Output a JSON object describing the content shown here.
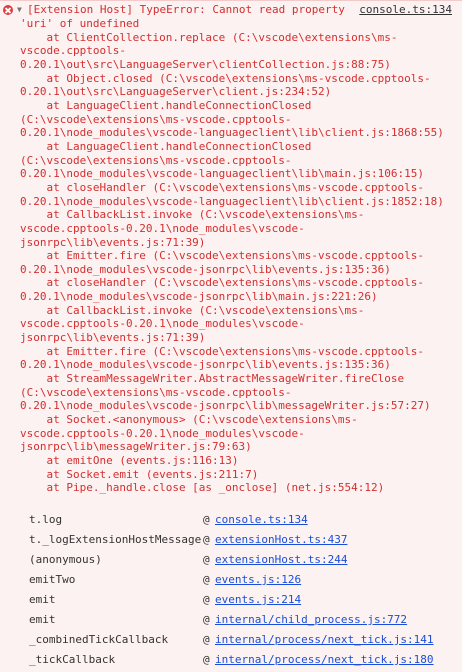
{
  "header": {
    "error_icon": "error-circle-icon",
    "expand_arrow": "▼",
    "message_line1": "[Extension Host] TypeError: Cannot read property",
    "source_link": "console.ts:134"
  },
  "stack_lines": [
    "'uri' of undefined",
    "    at ClientCollection.replace (C:\\vscode\\extensions\\ms-",
    "vscode.cpptools-",
    "0.20.1\\out\\src\\LanguageServer\\clientCollection.js:88:75)",
    "    at Object.closed (C:\\vscode\\extensions\\ms-vscode.cpptools-",
    "0.20.1\\out\\src\\LanguageServer\\client.js:234:52)",
    "    at LanguageClient.handleConnectionClosed",
    "(C:\\vscode\\extensions\\ms-vscode.cpptools-",
    "0.20.1\\node_modules\\vscode-languageclient\\lib\\client.js:1868:55)",
    "    at LanguageClient.handleConnectionClosed",
    "(C:\\vscode\\extensions\\ms-vscode.cpptools-",
    "0.20.1\\node_modules\\vscode-languageclient\\lib\\main.js:106:15)",
    "    at closeHandler (C:\\vscode\\extensions\\ms-vscode.cpptools-",
    "0.20.1\\node_modules\\vscode-languageclient\\lib\\client.js:1852:18)",
    "    at CallbackList.invoke (C:\\vscode\\extensions\\ms-",
    "vscode.cpptools-0.20.1\\node_modules\\vscode-",
    "jsonrpc\\lib\\events.js:71:39)",
    "    at Emitter.fire (C:\\vscode\\extensions\\ms-vscode.cpptools-",
    "0.20.1\\node_modules\\vscode-jsonrpc\\lib\\events.js:135:36)",
    "    at closeHandler (C:\\vscode\\extensions\\ms-vscode.cpptools-",
    "0.20.1\\node_modules\\vscode-jsonrpc\\lib\\main.js:221:26)",
    "    at CallbackList.invoke (C:\\vscode\\extensions\\ms-",
    "vscode.cpptools-0.20.1\\node_modules\\vscode-",
    "jsonrpc\\lib\\events.js:71:39)",
    "    at Emitter.fire (C:\\vscode\\extensions\\ms-vscode.cpptools-",
    "0.20.1\\node_modules\\vscode-jsonrpc\\lib\\events.js:135:36)",
    "    at StreamMessageWriter.AbstractMessageWriter.fireClose",
    "(C:\\vscode\\extensions\\ms-vscode.cpptools-",
    "0.20.1\\node_modules\\vscode-jsonrpc\\lib\\messageWriter.js:57:27)",
    "    at Socket.<anonymous> (C:\\vscode\\extensions\\ms-",
    "vscode.cpptools-0.20.1\\node_modules\\vscode-",
    "jsonrpc\\lib\\messageWriter.js:79:63)",
    "    at emitOne (events.js:116:13)",
    "    at Socket.emit (events.js:211:7)",
    "    at Pipe._handle.close [as _onclose] (net.js:554:12)"
  ],
  "frames": [
    {
      "fn": "t.log",
      "at": "@",
      "link": "console.ts:134"
    },
    {
      "fn": "t._logExtensionHostMessage",
      "at": "@",
      "link": "extensionHost.ts:437"
    },
    {
      "fn": "(anonymous)",
      "at": "@",
      "link": "extensionHost.ts:244"
    },
    {
      "fn": "emitTwo",
      "at": "@",
      "link": "events.js:126"
    },
    {
      "fn": "emit",
      "at": "@",
      "link": "events.js:214"
    },
    {
      "fn": "emit",
      "at": "@",
      "link": "internal/child_process.js:772"
    },
    {
      "fn": "_combinedTickCallback",
      "at": "@",
      "link": "internal/process/next_tick.js:141"
    },
    {
      "fn": "_tickCallback",
      "at": "@",
      "link": "internal/process/next_tick.js:180"
    }
  ],
  "colors": {
    "background": "#fdf2f2",
    "error_text": "#d32f2f",
    "link": "#1a4ed8",
    "error_icon": "#e23b3b"
  }
}
